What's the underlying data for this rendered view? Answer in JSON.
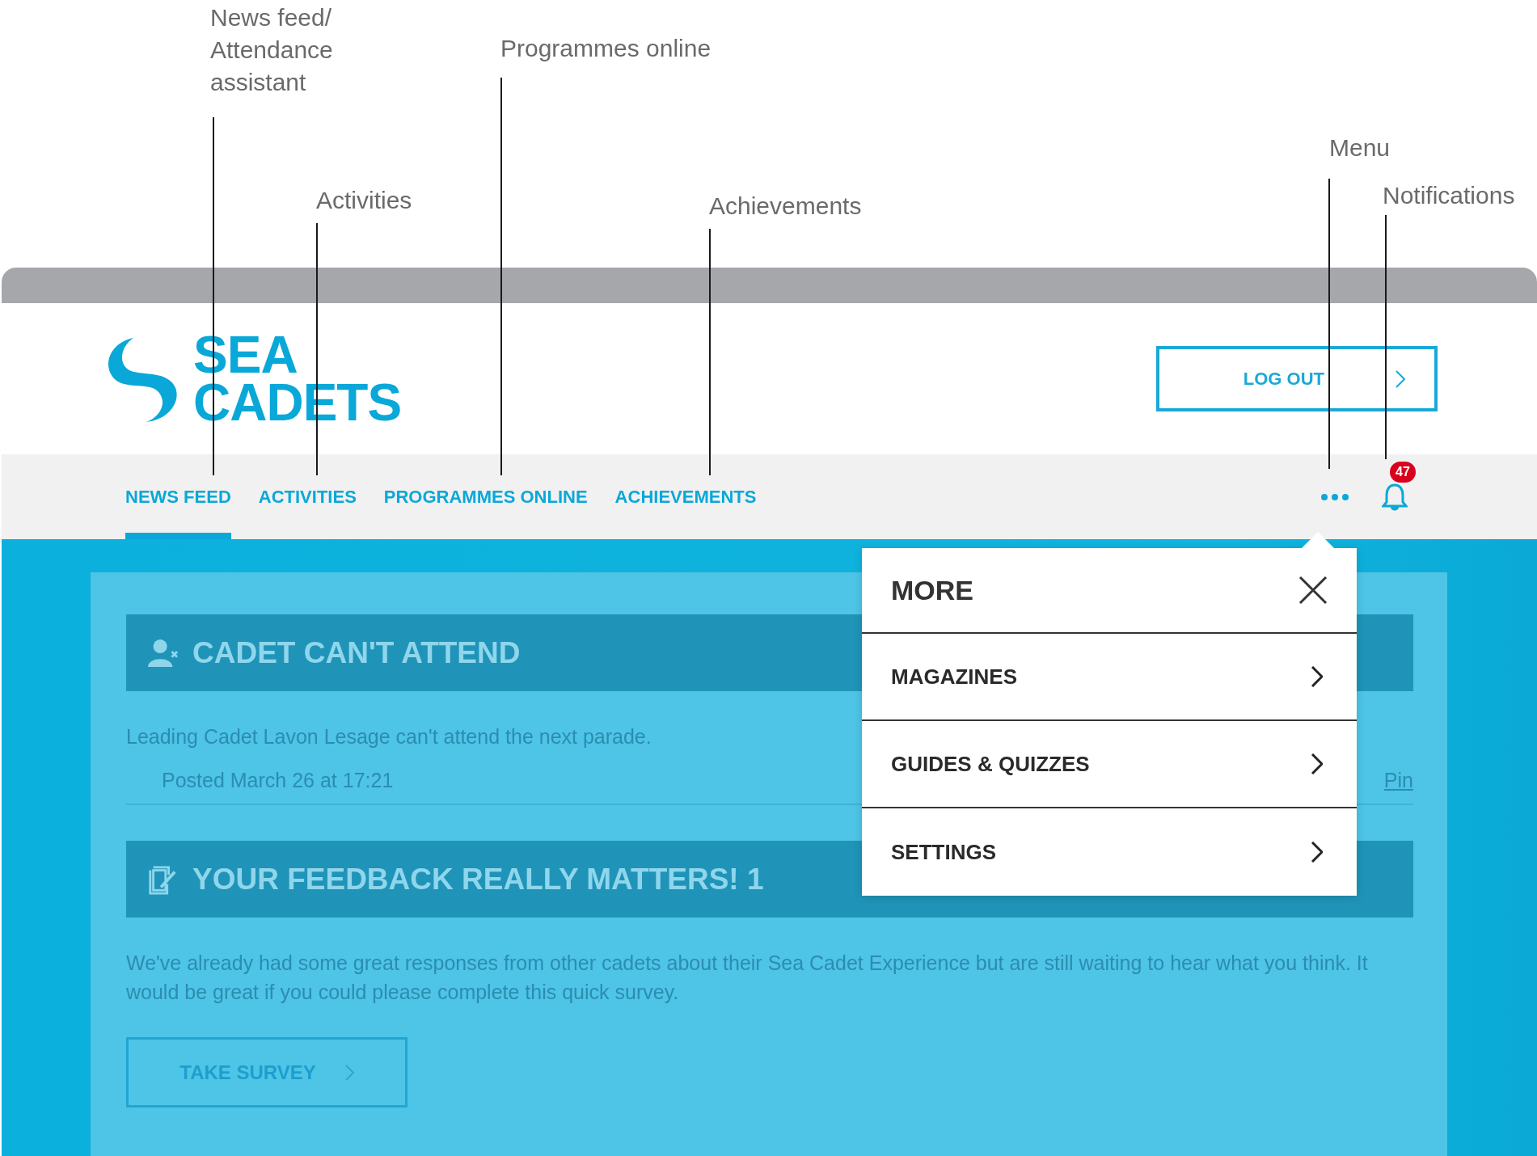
{
  "annotations": [
    {
      "label": "News feed/ Attendance assistant"
    },
    {
      "label": "Activities"
    },
    {
      "label": "Programmes online"
    },
    {
      "label": "Achievements"
    },
    {
      "label": "Menu"
    },
    {
      "label": "Notifications"
    }
  ],
  "logo_text": "SEA CADETS",
  "logout_button": "LOG OUT",
  "nav": [
    {
      "label": "NEWS FEED",
      "selected": true
    },
    {
      "label": "ACTIVITIES",
      "selected": false
    },
    {
      "label": "PROGRAMMES ONLINE",
      "selected": false
    },
    {
      "label": "ACHIEVEMENTS",
      "selected": false
    }
  ],
  "notification_count": "47",
  "cards": [
    {
      "kind": "attendance",
      "title": "CADET CAN'T ATTEND",
      "body": "Leading Cadet Lavon Lesage can't attend the next parade.",
      "posted": "Posted March 26 at 17:21",
      "pin_link": "Pin"
    },
    {
      "kind": "feedback",
      "title": "YOUR FEEDBACK REALLY MATTERS! 1",
      "body": "We've already had some great responses from other cadets about their Sea Cadet Experience but are still waiting to hear what you think. It would be great if you could please complete this quick survey.",
      "button": "TAKE SURVEY"
    }
  ],
  "more_menu": {
    "open": true,
    "title": "MORE",
    "items": [
      {
        "label": "MAGAZINES"
      },
      {
        "label": "GUIDES & QUIZZES"
      },
      {
        "label": "SETTINGS"
      }
    ]
  }
}
